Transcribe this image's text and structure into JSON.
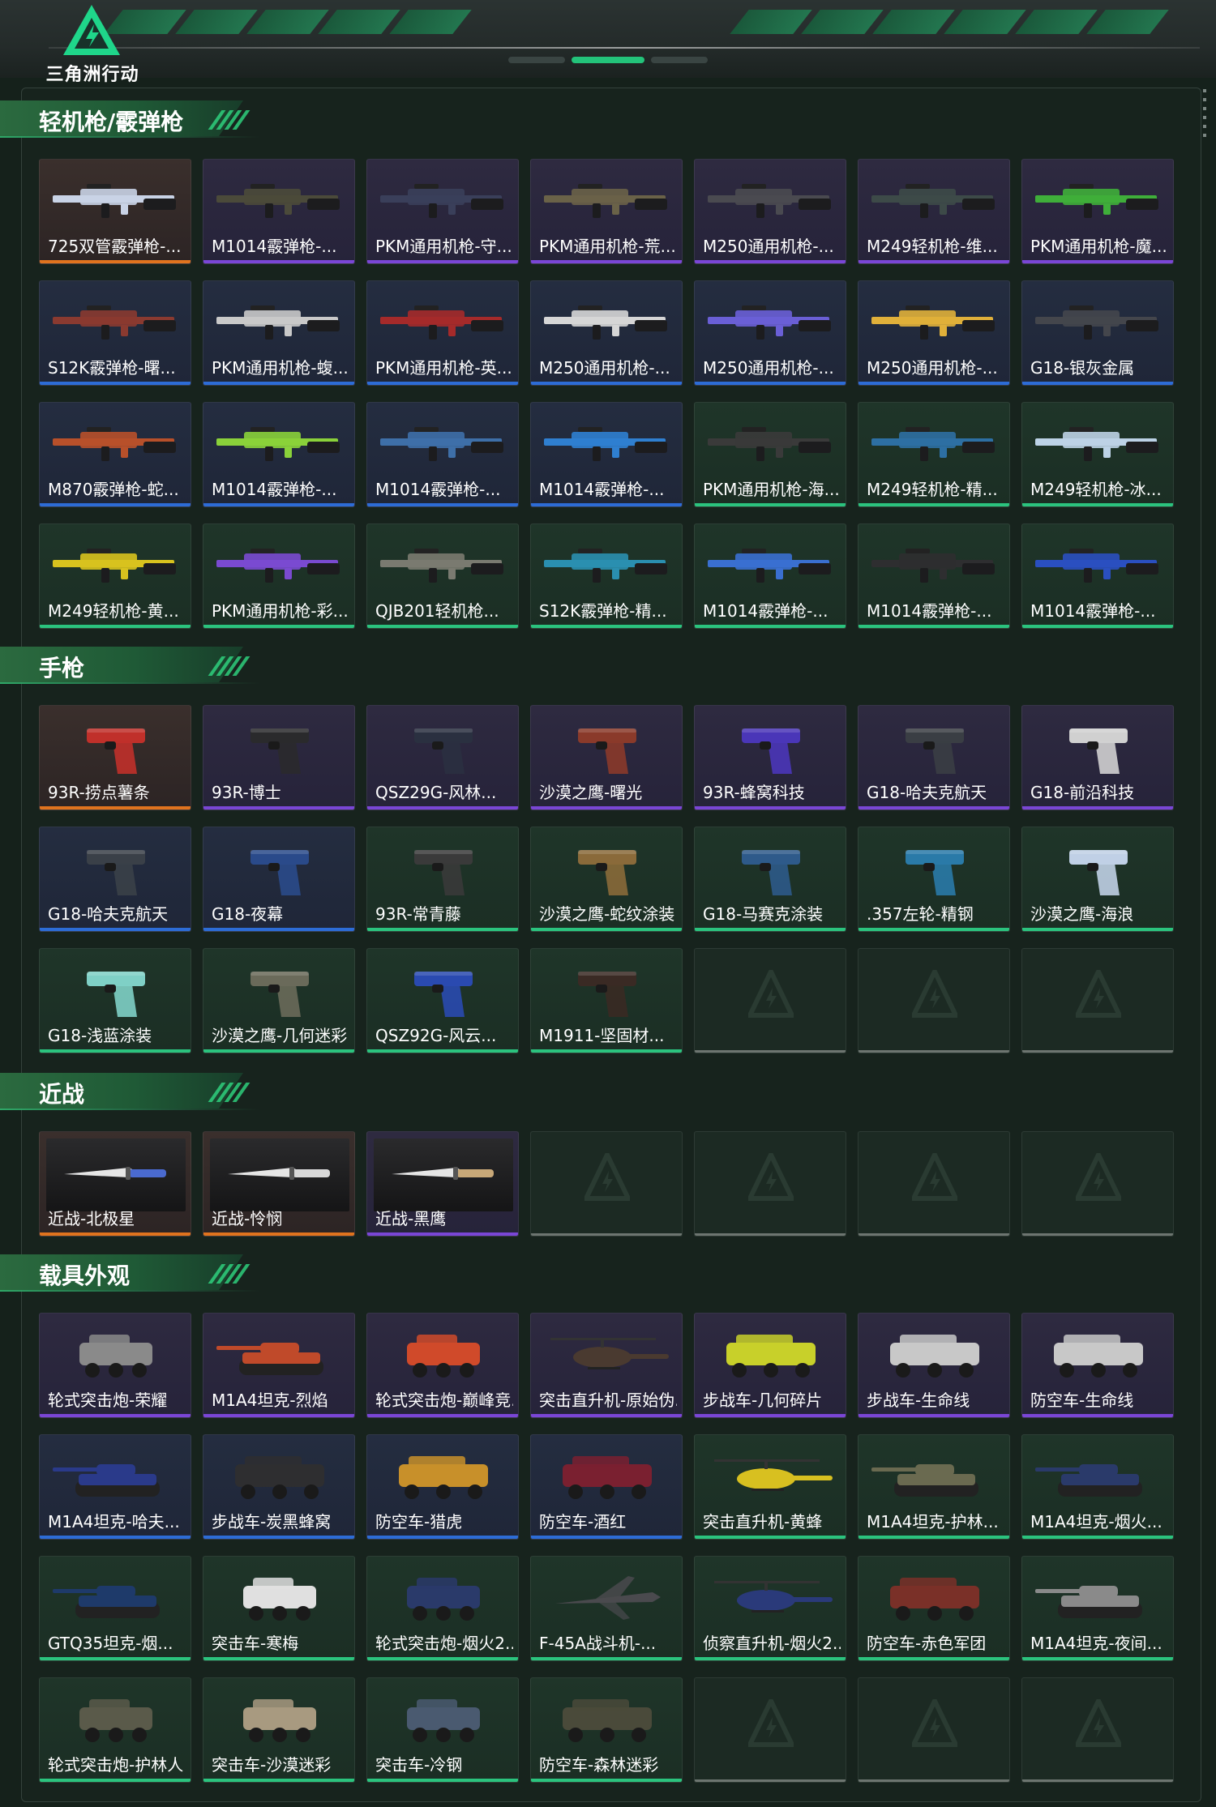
{
  "app": {
    "logo_text": "三角洲行动"
  },
  "sections": [
    {
      "key": "lmg",
      "title": "轻机枪/霰弹枪",
      "items": [
        {
          "label": "725双管霰弹枪-...",
          "rarity": "orange",
          "kind": "rifle",
          "color": "#c9d3e6"
        },
        {
          "label": "M1014霰弹枪-...",
          "rarity": "purple",
          "kind": "rifle",
          "color": "#4b4a3a"
        },
        {
          "label": "PKM通用机枪-守...",
          "rarity": "purple",
          "kind": "rifle",
          "color": "#3a3f5a"
        },
        {
          "label": "PKM通用机枪-荒...",
          "rarity": "purple",
          "kind": "rifle",
          "color": "#6a6248"
        },
        {
          "label": "M250通用机枪-...",
          "rarity": "purple",
          "kind": "rifle",
          "color": "#4a4a50"
        },
        {
          "label": "M249轻机枪-维...",
          "rarity": "purple",
          "kind": "rifle",
          "color": "#3d4a48"
        },
        {
          "label": "PKM通用机枪-魔...",
          "rarity": "purple",
          "kind": "rifle",
          "color": "#3fae3a"
        },
        {
          "label": "S12K霰弹枪-曙...",
          "rarity": "blue",
          "kind": "rifle",
          "color": "#8a3a30"
        },
        {
          "label": "PKM通用机枪-蝮...",
          "rarity": "blue",
          "kind": "rifle",
          "color": "#c9c9c9"
        },
        {
          "label": "PKM通用机枪-英...",
          "rarity": "blue",
          "kind": "rifle",
          "color": "#a52a2a"
        },
        {
          "label": "M250通用机枪-...",
          "rarity": "blue",
          "kind": "rifle",
          "color": "#d6d6d6"
        },
        {
          "label": "M250通用机枪-...",
          "rarity": "blue",
          "kind": "rifle",
          "color": "#6a5fd6"
        },
        {
          "label": "M250通用机枪-...",
          "rarity": "blue",
          "kind": "rifle",
          "color": "#e0b03a"
        },
        {
          "label": "G18-银灰金属",
          "rarity": "blue",
          "kind": "rifle",
          "color": "#44464c"
        },
        {
          "label": "M870霰弹枪-蛇...",
          "rarity": "blue",
          "kind": "rifle",
          "color": "#b8502a"
        },
        {
          "label": "M1014霰弹枪-...",
          "rarity": "blue",
          "kind": "rifle",
          "color": "#8ad13a"
        },
        {
          "label": "M1014霰弹枪-...",
          "rarity": "blue",
          "kind": "rifle",
          "color": "#3e6fa8"
        },
        {
          "label": "M1014霰弹枪-...",
          "rarity": "blue",
          "kind": "rifle",
          "color": "#2f7fd0"
        },
        {
          "label": "PKM通用机枪-海...",
          "rarity": "green",
          "kind": "rifle",
          "color": "#3a3a3a"
        },
        {
          "label": "M249轻机枪-精...",
          "rarity": "green",
          "kind": "rifle",
          "color": "#2d6fa3"
        },
        {
          "label": "M249轻机枪-冰...",
          "rarity": "green",
          "kind": "rifle",
          "color": "#bcd2e6"
        },
        {
          "label": "M249轻机枪-黄...",
          "rarity": "green",
          "kind": "rifle",
          "color": "#d8c21e"
        },
        {
          "label": "PKM通用机枪-彩...",
          "rarity": "green",
          "kind": "rifle",
          "color": "#7a4ad0"
        },
        {
          "label": "QJB201轻机枪...",
          "rarity": "green",
          "kind": "rifle",
          "color": "#7a7a70"
        },
        {
          "label": "S12K霰弹枪-精...",
          "rarity": "green",
          "kind": "rifle",
          "color": "#2a8fb0"
        },
        {
          "label": "M1014霰弹枪-...",
          "rarity": "green",
          "kind": "rifle",
          "color": "#3a6fd0"
        },
        {
          "label": "M1014霰弹枪-...",
          "rarity": "green",
          "kind": "rifle",
          "color": "#2e2e30"
        },
        {
          "label": "M1014霰弹枪-...",
          "rarity": "green",
          "kind": "rifle",
          "color": "#2a4fc0"
        }
      ]
    },
    {
      "key": "pistol",
      "title": "手枪",
      "items": [
        {
          "label": "93R-捞点薯条",
          "rarity": "orange",
          "kind": "pistol",
          "color": "#c0302a"
        },
        {
          "label": "93R-博士",
          "rarity": "purple",
          "kind": "pistol",
          "color": "#2a2a2c"
        },
        {
          "label": "QSZ29G-风林...",
          "rarity": "purple",
          "kind": "pistol",
          "color": "#2a3040"
        },
        {
          "label": "沙漠之鹰-曙光",
          "rarity": "purple",
          "kind": "pistol",
          "color": "#8a3a2a"
        },
        {
          "label": "93R-蜂窝科技",
          "rarity": "purple",
          "kind": "pistol",
          "color": "#4a36b8"
        },
        {
          "label": "G18-哈夫克航天",
          "rarity": "purple",
          "kind": "pistol",
          "color": "#3a3e44"
        },
        {
          "label": "G18-前沿科技",
          "rarity": "purple",
          "kind": "pistol",
          "color": "#d0d0d0"
        },
        {
          "label": "G18-哈夫克航天",
          "rarity": "blue",
          "kind": "pistol",
          "color": "#3a4048"
        },
        {
          "label": "G18-夜幕",
          "rarity": "blue",
          "kind": "pistol",
          "color": "#2a4a8a"
        },
        {
          "label": "93R-常青藤",
          "rarity": "green",
          "kind": "pistol",
          "color": "#3a3a3a"
        },
        {
          "label": "沙漠之鹰-蛇纹涂装",
          "rarity": "green",
          "kind": "pistol",
          "color": "#8a6a3a"
        },
        {
          "label": "G18-马赛克涂装",
          "rarity": "green",
          "kind": "pistol",
          "color": "#2e5a8a"
        },
        {
          "label": ".357左轮-精钢",
          "rarity": "green",
          "kind": "pistol",
          "color": "#2a7aa8"
        },
        {
          "label": "沙漠之鹰-海浪",
          "rarity": "green",
          "kind": "pistol",
          "color": "#c0d0e6"
        },
        {
          "label": "G18-浅蓝涂装",
          "rarity": "green",
          "kind": "pistol",
          "color": "#7fd0c6"
        },
        {
          "label": "沙漠之鹰-几何迷彩",
          "rarity": "green",
          "kind": "pistol",
          "color": "#6a6a5a"
        },
        {
          "label": "QSZ92G-风云...",
          "rarity": "green",
          "kind": "pistol",
          "color": "#2a4ab0"
        },
        {
          "label": "M1911-坚固材...",
          "rarity": "green",
          "kind": "pistol",
          "color": "#3a2a24"
        },
        {
          "label": "",
          "rarity": "empty",
          "kind": "empty",
          "color": ""
        },
        {
          "label": "",
          "rarity": "empty",
          "kind": "empty",
          "color": ""
        },
        {
          "label": "",
          "rarity": "empty",
          "kind": "empty",
          "color": ""
        }
      ]
    },
    {
      "key": "melee",
      "title": "近战",
      "items": [
        {
          "label": "近战-北极星",
          "rarity": "orange",
          "kind": "knife",
          "color": "#4a6ad0"
        },
        {
          "label": "近战-怜悯",
          "rarity": "orange",
          "kind": "knife",
          "color": "#d8d8d8"
        },
        {
          "label": "近战-黑鹰",
          "rarity": "purple",
          "kind": "knife",
          "color": "#c8a878"
        },
        {
          "label": "",
          "rarity": "empty",
          "kind": "empty",
          "color": ""
        },
        {
          "label": "",
          "rarity": "empty",
          "kind": "empty",
          "color": ""
        },
        {
          "label": "",
          "rarity": "empty",
          "kind": "empty",
          "color": ""
        },
        {
          "label": "",
          "rarity": "empty",
          "kind": "empty",
          "color": ""
        }
      ]
    },
    {
      "key": "vehicle",
      "title": "载具外观",
      "items": [
        {
          "label": "轮式突击炮-荣耀",
          "rarity": "purple",
          "kind": "car",
          "color": "#8a8a8a"
        },
        {
          "label": "M1A4坦克-烈焰",
          "rarity": "purple",
          "kind": "tank",
          "color": "#c04a2a"
        },
        {
          "label": "轮式突击炮-巅峰竞...",
          "rarity": "purple",
          "kind": "car",
          "color": "#d04a2a"
        },
        {
          "label": "突击直升机-原始伪...",
          "rarity": "purple",
          "kind": "heli",
          "color": "#4a3a30"
        },
        {
          "label": "步战车-几何碎片",
          "rarity": "purple",
          "kind": "apc",
          "color": "#c8d02a"
        },
        {
          "label": "步战车-生命线",
          "rarity": "purple",
          "kind": "apc",
          "color": "#c8c8c8"
        },
        {
          "label": "防空车-生命线",
          "rarity": "purple",
          "kind": "apc",
          "color": "#c8c8c8"
        },
        {
          "label": "M1A4坦克-哈夫...",
          "rarity": "blue",
          "kind": "tank",
          "color": "#2a3a8a"
        },
        {
          "label": "步战车-炭黑蜂窝",
          "rarity": "blue",
          "kind": "apc",
          "color": "#2e2e30"
        },
        {
          "label": "防空车-猎虎",
          "rarity": "blue",
          "kind": "apc",
          "color": "#c8902a"
        },
        {
          "label": "防空车-酒红",
          "rarity": "blue",
          "kind": "apc",
          "color": "#7a2030"
        },
        {
          "label": "突击直升机-黄蜂",
          "rarity": "green",
          "kind": "heli",
          "color": "#d8c020"
        },
        {
          "label": "M1A4坦克-护林...",
          "rarity": "green",
          "kind": "tank",
          "color": "#6a6a50"
        },
        {
          "label": "M1A4坦克-烟火...",
          "rarity": "green",
          "kind": "tank",
          "color": "#2a3a6a"
        },
        {
          "label": "GTQ35坦克-烟...",
          "rarity": "green",
          "kind": "tank",
          "color": "#1e3a6a"
        },
        {
          "label": "突击车-寒梅",
          "rarity": "green",
          "kind": "car",
          "color": "#e0e0e0"
        },
        {
          "label": "轮式突击炮-烟火2...",
          "rarity": "green",
          "kind": "car",
          "color": "#2a3a6a"
        },
        {
          "label": "F-45A战斗机-...",
          "rarity": "green",
          "kind": "jet",
          "color": "#4a4a4e"
        },
        {
          "label": "侦察直升机-烟火2...",
          "rarity": "green",
          "kind": "heli",
          "color": "#2a3a7a"
        },
        {
          "label": "防空车-赤色军团",
          "rarity": "green",
          "kind": "apc",
          "color": "#7a3028"
        },
        {
          "label": "M1A4坦克-夜间...",
          "rarity": "green",
          "kind": "tank",
          "color": "#8a8a8a"
        },
        {
          "label": "轮式突击炮-护林人",
          "rarity": "green",
          "kind": "car",
          "color": "#5a5a4a"
        },
        {
          "label": "突击车-沙漠迷彩",
          "rarity": "green",
          "kind": "car",
          "color": "#a89a80"
        },
        {
          "label": "突击车-冷钢",
          "rarity": "green",
          "kind": "car",
          "color": "#4a5a70"
        },
        {
          "label": "防空车-森林迷彩",
          "rarity": "green",
          "kind": "apc",
          "color": "#4a4a3a"
        },
        {
          "label": "",
          "rarity": "empty",
          "kind": "empty",
          "color": ""
        },
        {
          "label": "",
          "rarity": "empty",
          "kind": "empty",
          "color": ""
        },
        {
          "label": "",
          "rarity": "empty",
          "kind": "empty",
          "color": ""
        }
      ]
    }
  ]
}
